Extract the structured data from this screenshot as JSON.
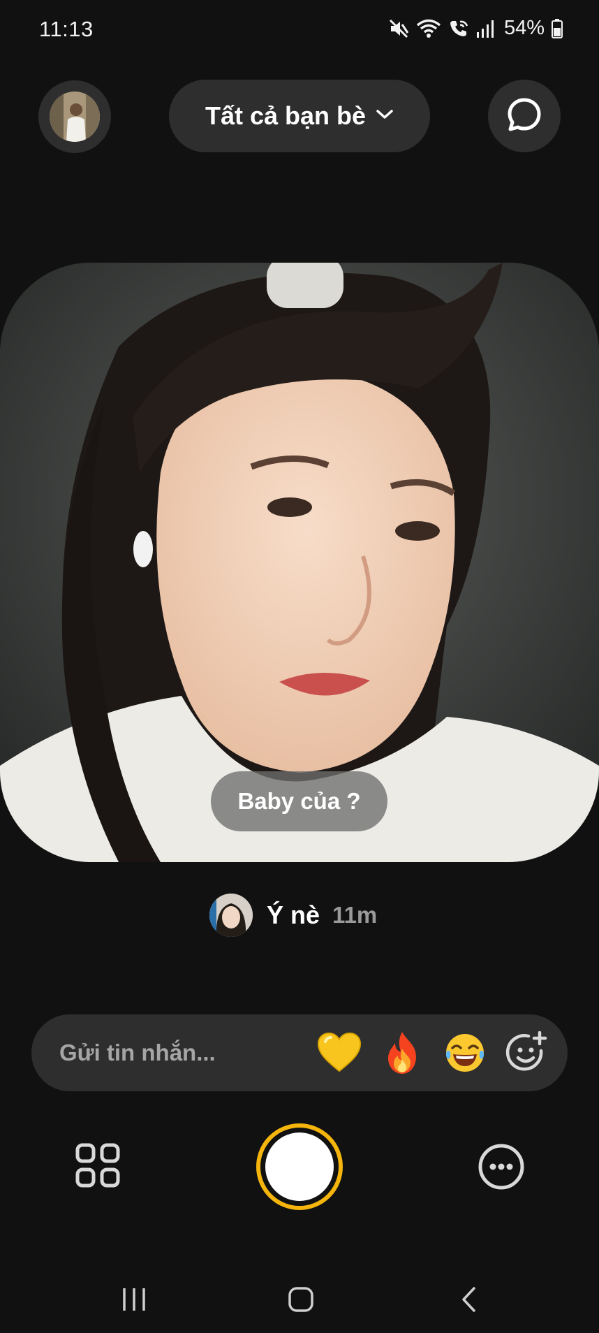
{
  "status_bar": {
    "time": "11:13",
    "battery": "54%",
    "icons": [
      "mute-icon",
      "wifi-icon",
      "wifi-call-icon",
      "signal-icon",
      "battery-icon"
    ]
  },
  "header": {
    "profile_icon": "profile-avatar",
    "audience_label": "Tất cả bạn bè",
    "audience_icon": "chevron-down-icon",
    "chat_icon": "chat-bubble-icon"
  },
  "post": {
    "caption": "Baby của ?",
    "author_name": "Ý nè",
    "time_ago": "11m"
  },
  "message_bar": {
    "placeholder": "Gửi tin nhắn...",
    "reactions": [
      "💛",
      "🔥",
      "😂"
    ],
    "add_reaction_icon": "add-emoji-icon"
  },
  "controls": {
    "grid_icon": "grid-icon",
    "shutter_icon": "shutter-button",
    "more_icon": "more-icon"
  },
  "nav": [
    "recent-apps-icon",
    "home-icon",
    "back-icon"
  ],
  "colors": {
    "background": "#111111",
    "surface": "#2e2e2e",
    "accent": "#f5b50c",
    "muted_text": "#9a9a9a"
  }
}
